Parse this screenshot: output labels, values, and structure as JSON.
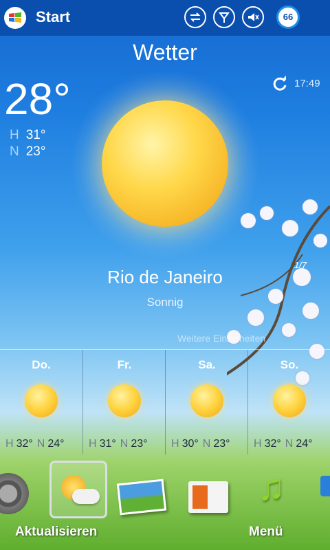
{
  "status_bar": {
    "start_label": "Start",
    "icons": [
      "data-sync-icon",
      "signal-icon",
      "speaker-muted-icon"
    ],
    "battery": "66"
  },
  "app": {
    "title": "Wetter"
  },
  "current": {
    "temp": "28°",
    "high_label": "H",
    "high": "31°",
    "low_label": "N",
    "low": "23°",
    "updated": "17:49",
    "city": "Rio de Janeiro",
    "condition": "Sonnig",
    "details_link": "Weitere Einzelheiten",
    "page_indicator": "1/7"
  },
  "forecast": [
    {
      "day": "Do.",
      "high": "32°",
      "low": "24°",
      "icon": "sun-icon"
    },
    {
      "day": "Fr.",
      "high": "31°",
      "low": "23°",
      "icon": "sun-icon"
    },
    {
      "day": "Sa.",
      "high": "30°",
      "low": "23°",
      "icon": "sun-icon"
    },
    {
      "day": "So.",
      "high": "32°",
      "low": "24°",
      "icon": "sun-icon"
    }
  ],
  "softkeys": {
    "left": "Aktualisieren",
    "right": "Menü"
  },
  "colors": {
    "statusbar": "#0b4fae",
    "accent_label": "#a9d4ff"
  }
}
